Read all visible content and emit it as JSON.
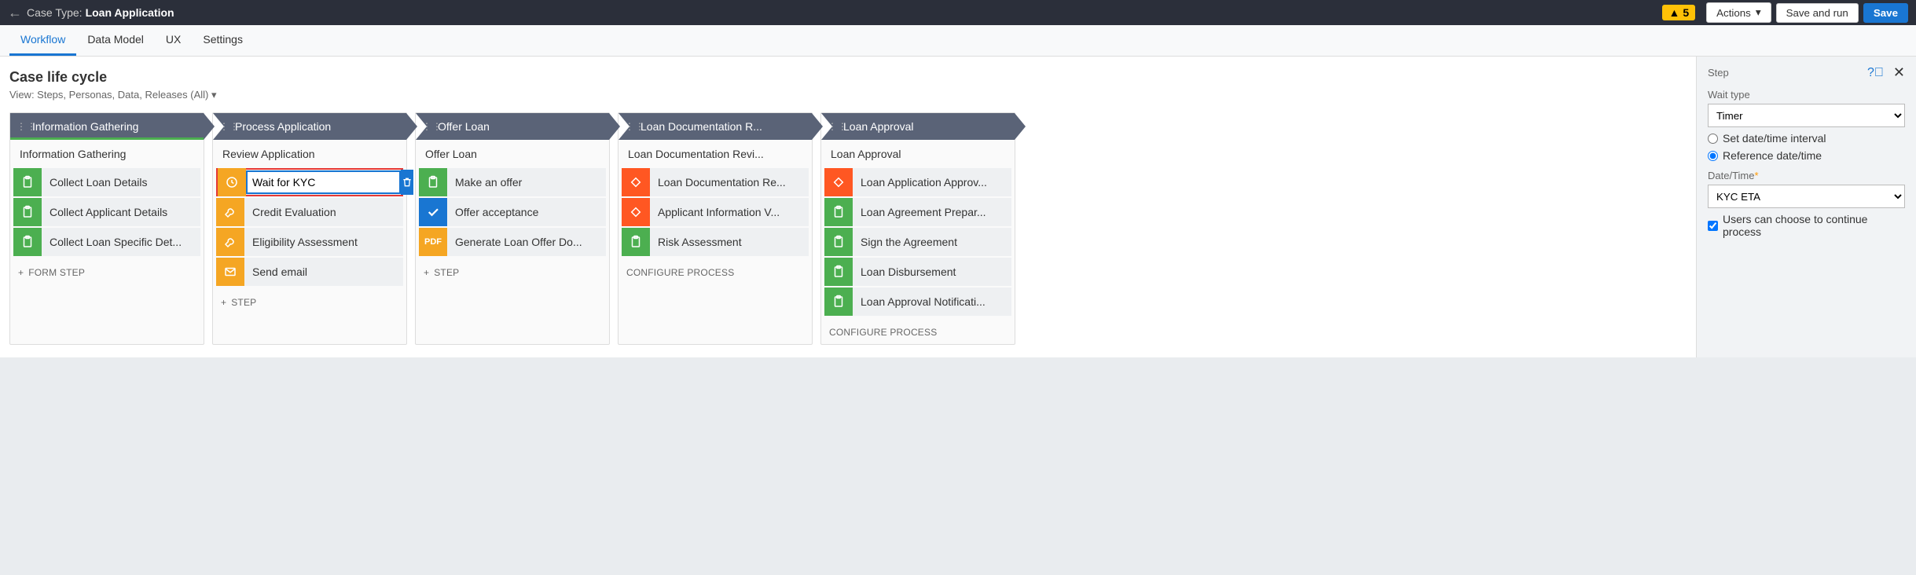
{
  "header": {
    "case_type_label": "Case Type:",
    "case_type_value": "Loan Application",
    "warning_count": "5",
    "actions_label": "Actions",
    "save_run_label": "Save and run",
    "save_label": "Save"
  },
  "tabs": [
    "Workflow",
    "Data Model",
    "UX",
    "Settings"
  ],
  "active_tab": 0,
  "page_title": "Case life cycle",
  "view_label": "View: Steps, Personas, Data, Releases (All)",
  "add_form_step": "FORM STEP",
  "add_step": "STEP",
  "configure_process": "CONFIGURE PROCESS",
  "stages": [
    {
      "name": "Information Gathering",
      "active": true,
      "process": "Information Gathering",
      "steps": [
        {
          "icon": "clipboard",
          "color": "green",
          "label": "Collect Loan Details"
        },
        {
          "icon": "clipboard",
          "color": "green",
          "label": "Collect Applicant Details"
        },
        {
          "icon": "clipboard",
          "color": "green",
          "label": "Collect Loan Specific Det..."
        }
      ],
      "footer": "form_step"
    },
    {
      "name": "Process Application",
      "process": "Review Application",
      "steps": [
        {
          "icon": "clock",
          "color": "orange",
          "label": "Wait for KYC",
          "selected": true
        },
        {
          "icon": "wrench",
          "color": "orange",
          "label": "Credit Evaluation"
        },
        {
          "icon": "wrench",
          "color": "orange",
          "label": "Eligibility Assessment"
        },
        {
          "icon": "mail",
          "color": "orange",
          "label": "Send email"
        }
      ],
      "footer": "step"
    },
    {
      "name": "Offer Loan",
      "process": "Offer Loan",
      "steps": [
        {
          "icon": "clipboard",
          "color": "green",
          "label": "Make an offer"
        },
        {
          "icon": "check",
          "color": "blue",
          "label": "Offer acceptance"
        },
        {
          "icon": "pdf",
          "color": "pdf",
          "label": "Generate Loan Offer Do..."
        }
      ],
      "footer": "step"
    },
    {
      "name": "Loan Documentation R...",
      "process": "Loan Documentation Revi...",
      "steps": [
        {
          "icon": "diamond",
          "color": "orangered",
          "label": "Loan Documentation Re..."
        },
        {
          "icon": "diamond",
          "color": "orangered",
          "label": "Applicant Information V..."
        },
        {
          "icon": "clipboard",
          "color": "green",
          "label": "Risk Assessment"
        }
      ],
      "footer": "configure"
    },
    {
      "name": "Loan Approval",
      "process": "Loan Approval",
      "steps": [
        {
          "icon": "diamond",
          "color": "orangered",
          "label": "Loan Application Approv..."
        },
        {
          "icon": "clipboard",
          "color": "green",
          "label": "Loan Agreement Prepar..."
        },
        {
          "icon": "clipboard",
          "color": "green",
          "label": "Sign the Agreement"
        },
        {
          "icon": "clipboard",
          "color": "green",
          "label": "Loan Disbursement"
        },
        {
          "icon": "clipboard",
          "color": "green",
          "label": "Loan Approval Notificati..."
        }
      ],
      "footer": "configure"
    }
  ],
  "panel": {
    "title": "Step",
    "wait_type_label": "Wait type",
    "wait_type_value": "Timer",
    "radio_interval": "Set date/time interval",
    "radio_reference": "Reference date/time",
    "datetime_label": "Date/Time",
    "datetime_value": "KYC ETA",
    "checkbox_label": "Users can choose to continue process"
  }
}
